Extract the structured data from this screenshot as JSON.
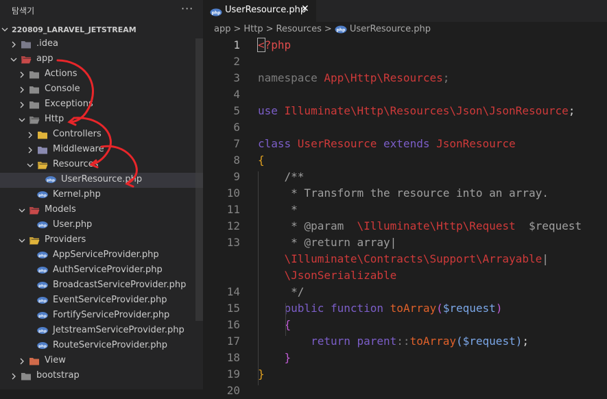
{
  "sidebar": {
    "title": "탐색기",
    "more": "···",
    "root": "220809_LARAVEL_JETSTREAM",
    "items": [
      {
        "label": ".idea",
        "depth": 0,
        "kind": "folder-idea",
        "expanded": false
      },
      {
        "label": "app",
        "depth": 0,
        "kind": "folder-app",
        "expanded": true
      },
      {
        "label": "Actions",
        "depth": 1,
        "kind": "folder",
        "expanded": false
      },
      {
        "label": "Console",
        "depth": 1,
        "kind": "folder",
        "expanded": false
      },
      {
        "label": "Exceptions",
        "depth": 1,
        "kind": "folder",
        "expanded": false
      },
      {
        "label": "Http",
        "depth": 1,
        "kind": "folder",
        "expanded": true
      },
      {
        "label": "Controllers",
        "depth": 2,
        "kind": "folder-controllers",
        "expanded": false
      },
      {
        "label": "Middleware",
        "depth": 2,
        "kind": "folder-middleware",
        "expanded": false
      },
      {
        "label": "Resources",
        "depth": 2,
        "kind": "folder-resources",
        "expanded": true
      },
      {
        "label": "UserResource.php",
        "depth": 3,
        "kind": "php",
        "selected": true
      },
      {
        "label": "Kernel.php",
        "depth": 2,
        "kind": "php"
      },
      {
        "label": "Models",
        "depth": 1,
        "kind": "folder-models",
        "expanded": true
      },
      {
        "label": "User.php",
        "depth": 2,
        "kind": "php"
      },
      {
        "label": "Providers",
        "depth": 1,
        "kind": "folder-providers",
        "expanded": true
      },
      {
        "label": "AppServiceProvider.php",
        "depth": 2,
        "kind": "php"
      },
      {
        "label": "AuthServiceProvider.php",
        "depth": 2,
        "kind": "php"
      },
      {
        "label": "BroadcastServiceProvider.php",
        "depth": 2,
        "kind": "php"
      },
      {
        "label": "EventServiceProvider.php",
        "depth": 2,
        "kind": "php"
      },
      {
        "label": "FortifyServiceProvider.php",
        "depth": 2,
        "kind": "php"
      },
      {
        "label": "JetstreamServiceProvider.php",
        "depth": 2,
        "kind": "php"
      },
      {
        "label": "RouteServiceProvider.php",
        "depth": 2,
        "kind": "php"
      },
      {
        "label": "View",
        "depth": 1,
        "kind": "folder-view",
        "expanded": false
      },
      {
        "label": "bootstrap",
        "depth": 0,
        "kind": "folder",
        "expanded": false
      }
    ]
  },
  "tab": {
    "label": "UserResource.php",
    "close": "✕"
  },
  "breadcrumb": [
    "app",
    "Http",
    "Resources",
    "UserResource.php"
  ],
  "code": {
    "lines": [
      {
        "n": "1",
        "tokens": [
          [
            "<",
            "ph",
            true
          ],
          [
            "?php",
            "ph"
          ]
        ]
      },
      {
        "n": "2",
        "tokens": []
      },
      {
        "n": "3",
        "tokens": [
          [
            "namespace ",
            "dim"
          ],
          [
            "App\\Http\\Resources",
            "ns"
          ],
          [
            ";",
            "dim"
          ]
        ]
      },
      {
        "n": "4",
        "tokens": []
      },
      {
        "n": "5",
        "tokens": [
          [
            "use ",
            "kw"
          ],
          [
            "Illuminate\\Http\\Resources\\Json\\JsonResource",
            "ns"
          ],
          [
            ";",
            ""
          ]
        ]
      },
      {
        "n": "6",
        "tokens": []
      },
      {
        "n": "7",
        "tokens": [
          [
            "class ",
            "kw"
          ],
          [
            "UserResource ",
            "cls"
          ],
          [
            "extends ",
            "kw"
          ],
          [
            "JsonResource",
            "cls"
          ]
        ]
      },
      {
        "n": "8",
        "tokens": [
          [
            "{",
            "br"
          ]
        ]
      },
      {
        "n": "9",
        "tokens": [
          [
            "    ",
            ""
          ],
          [
            "/**",
            "com"
          ]
        ]
      },
      {
        "n": "10",
        "tokens": [
          [
            "     * Transform the resource into an array.",
            "com"
          ]
        ]
      },
      {
        "n": "11",
        "tokens": [
          [
            "     *",
            "com"
          ]
        ]
      },
      {
        "n": "12",
        "tokens": [
          [
            "     * ",
            "com"
          ],
          [
            "@param",
            "star"
          ],
          [
            "  ",
            "com"
          ],
          [
            "\\Illuminate\\Http\\Request",
            "ns"
          ],
          [
            "  $request",
            "com"
          ]
        ]
      },
      {
        "n": "13",
        "tokens": [
          [
            "     * ",
            "com"
          ],
          [
            "@return",
            "star"
          ],
          [
            " array|",
            "com"
          ]
        ]
      },
      {
        "n": "",
        "tokens": [
          [
            "    ",
            ""
          ],
          [
            "\\Illuminate\\Contracts\\Support\\Arrayable",
            "ns"
          ],
          [
            "|",
            "com"
          ]
        ]
      },
      {
        "n": "",
        "tokens": [
          [
            "    ",
            ""
          ],
          [
            "\\JsonSerializable",
            "ns"
          ]
        ]
      },
      {
        "n": "14",
        "tokens": [
          [
            "     */",
            "com"
          ]
        ]
      },
      {
        "n": "15",
        "tokens": [
          [
            "    ",
            ""
          ],
          [
            "public ",
            "kw"
          ],
          [
            "function ",
            "kw"
          ],
          [
            "toArray",
            "fn"
          ],
          [
            "(",
            "br2"
          ],
          [
            "$request",
            "var"
          ],
          [
            ")",
            "br2"
          ]
        ]
      },
      {
        "n": "16",
        "tokens": [
          [
            "    ",
            ""
          ],
          [
            "{",
            "br2"
          ]
        ]
      },
      {
        "n": "17",
        "tokens": [
          [
            "        ",
            ""
          ],
          [
            "return ",
            "kw"
          ],
          [
            "parent",
            "kw"
          ],
          [
            "::",
            "dim"
          ],
          [
            "toArray",
            "fn"
          ],
          [
            "(",
            "var"
          ],
          [
            "$request",
            "var"
          ],
          [
            ")",
            "var"
          ],
          [
            ";",
            ""
          ]
        ]
      },
      {
        "n": "18",
        "tokens": [
          [
            "    ",
            ""
          ],
          [
            "}",
            "br2"
          ]
        ]
      },
      {
        "n": "19",
        "tokens": [
          [
            "}",
            "br"
          ]
        ]
      },
      {
        "n": "20",
        "tokens": []
      }
    ]
  }
}
